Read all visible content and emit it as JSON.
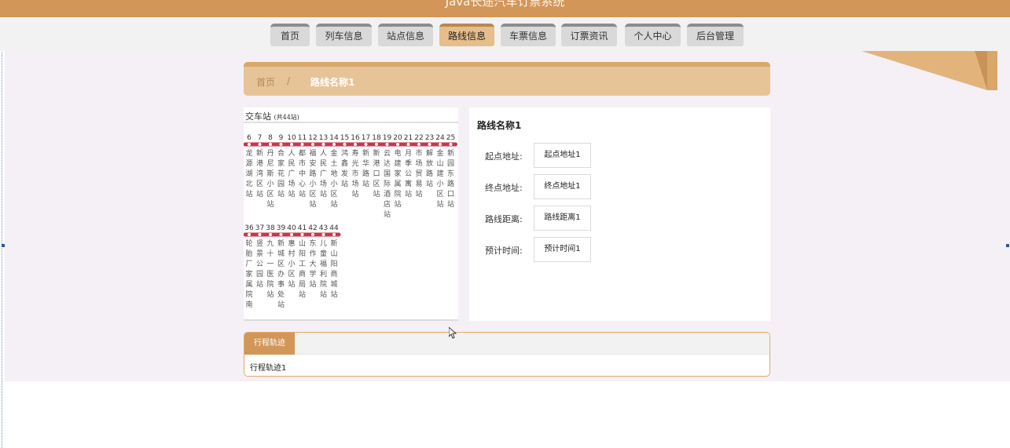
{
  "site": {
    "title": "Java长途汽车订票系统"
  },
  "nav": {
    "items": [
      {
        "label": "首页"
      },
      {
        "label": "列车信息"
      },
      {
        "label": "站点信息"
      },
      {
        "label": "路线信息"
      },
      {
        "label": "车票信息"
      },
      {
        "label": "订票资讯"
      },
      {
        "label": "个人中心"
      },
      {
        "label": "后台管理"
      }
    ],
    "active": "路线信息"
  },
  "breadcrumb": {
    "home": "首页",
    "separator": "/",
    "current": "路线名称1"
  },
  "route_map": {
    "title": "交车站",
    "count_label": "(共44站)",
    "row1_numbers": [
      "6",
      "7",
      "8",
      "9",
      "10",
      "11",
      "12",
      "13",
      "14",
      "15",
      "16",
      "17",
      "18",
      "19",
      "20",
      "21",
      "22",
      "23",
      "24",
      "25"
    ],
    "row1_stations": [
      "龙源湖北站",
      "新港湾区站",
      "丹尼斯小区站",
      "合家花园站",
      "人民广场站",
      "都市中心站",
      "福安路小区站",
      "人民广场站",
      "金土地小区站",
      "鸿鑫发站",
      "寿光市场站",
      "新华路站",
      "新港口区站",
      "云达国际酒店站",
      "电建家属院站",
      "月季公寓站",
      "市场贸易站",
      "解放路站",
      "金山建小区站",
      "新园东路口站"
    ],
    "row2_numbers": [
      "36",
      "37",
      "38",
      "39",
      "40",
      "41",
      "42",
      "43",
      "44"
    ],
    "row2_stations": [
      "轮胎厂家属院南",
      "竖景公园站",
      "九十一医院站",
      "新城区办事处站",
      "惠村小区站",
      "山阳工商局站",
      "东作大学站",
      "儿童福利院站",
      "新山阳商城站"
    ],
    "line_color": "#c8374d"
  },
  "route_info": {
    "title": "路线名称1",
    "fields": [
      {
        "label": "起点地址:",
        "value": "起点地址1"
      },
      {
        "label": "终点地址:",
        "value": "终点地址1"
      },
      {
        "label": "路线距离:",
        "value": "路线距离1"
      },
      {
        "label": "预计时间:",
        "value": "预计时间1"
      }
    ]
  },
  "track": {
    "tab_label": "行程轨迹",
    "content": "行程轨迹1"
  },
  "colors": {
    "brand": "#d29658",
    "active_tab": "#e6bd8b",
    "breadcrumb": "#e7c498"
  }
}
